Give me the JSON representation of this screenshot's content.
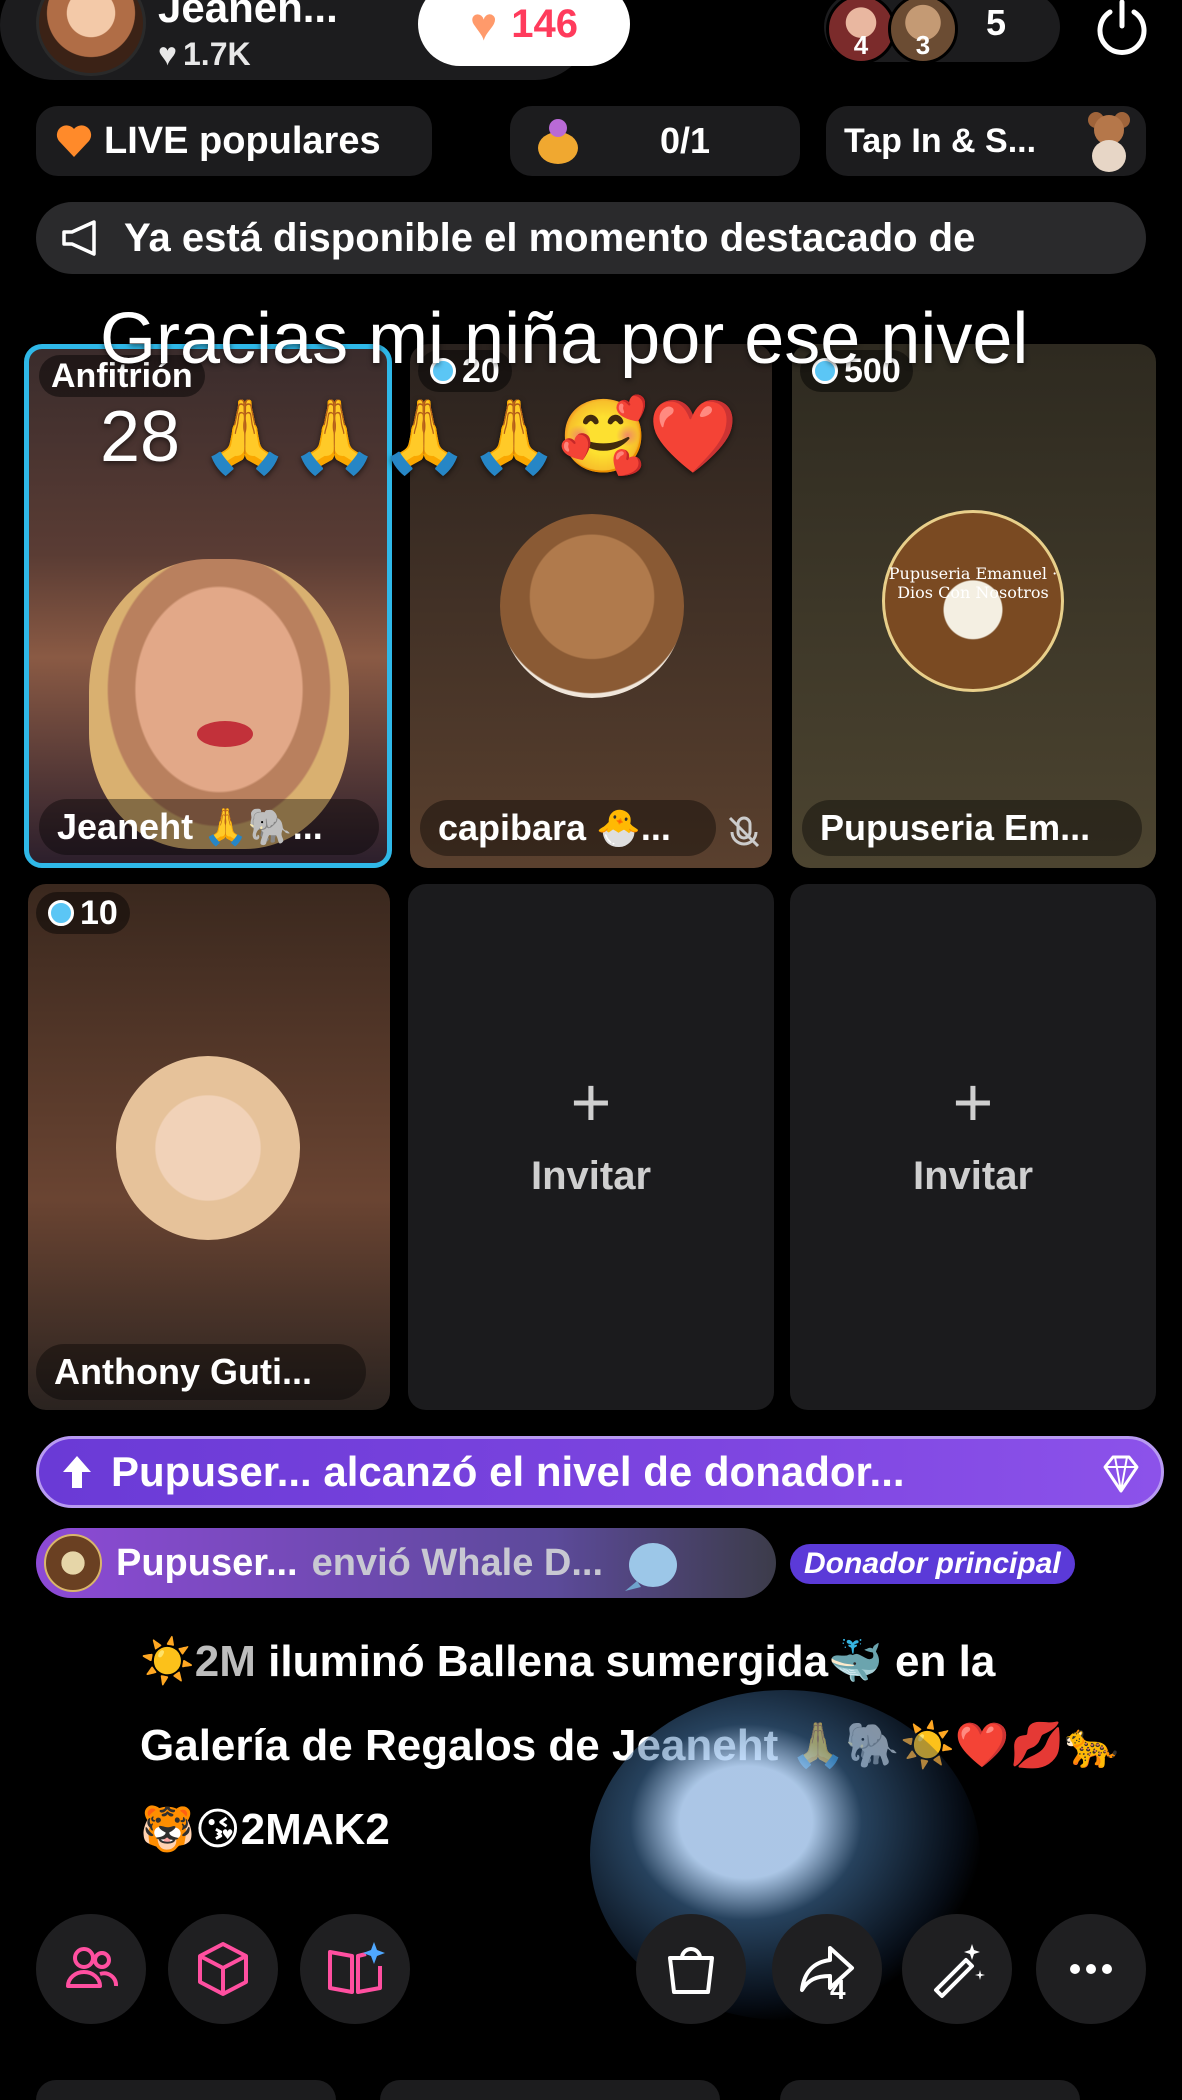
{
  "header": {
    "host_name": "Jeaneh...",
    "host_likes": "1.7K",
    "heart_count": "146",
    "viewer_badge_1": "4",
    "viewer_badge_2": "3",
    "viewer_count": "5"
  },
  "row2": {
    "live_popular": "LIVE populares",
    "task_progress": "0/1",
    "tap_in": "Tap In & S..."
  },
  "announcement": "Ya está disponible el momento destacado de",
  "caption": "Gracias mi niña por ese nivel 28 🙏🙏🙏🙏🥰❤️",
  "grid": {
    "host_tag": "Anfitrión",
    "host_name": "Jeaneht 🙏🐘...",
    "cell2_level": "20",
    "cell2_name": "capibara 🐣...",
    "cell3_level": "500",
    "cell3_name": "Pupuseria Em...",
    "cell3_logo_text": "Pupuseria Emanuel · Dios Con Nosotros",
    "cell4_level": "10",
    "cell4_name": "Anthony Guti...",
    "invite_plus": "+",
    "invite_label": "Invitar"
  },
  "donor": {
    "banner": "Pupuser... alcanzó el nivel de donador...",
    "gift_name": "Pupuser...",
    "gift_sent": "envió Whale D...",
    "top_donor": "Donador principal"
  },
  "comment": {
    "prefix": "☀️",
    "user": "2M",
    "text": " iluminó Ballena sumergida🐳 en la Galería de Regalos de Jeaneht 🙏🐘☀️❤️💋🐆🐯😘2MAK2"
  },
  "bottom": {
    "share_count": "4"
  },
  "colors": {
    "host_border": "#2fb8e8",
    "heart_number": "#ff3b5c",
    "donor_purple": "#7d45e0"
  },
  "icons": [
    "heart-icon",
    "power-icon",
    "megaphone-icon",
    "people-icon",
    "cube-icon",
    "book-sparkle-icon",
    "bag-icon",
    "share-icon",
    "magic-wand-icon",
    "more-icon",
    "diamond-icon",
    "mic-off-icon"
  ]
}
